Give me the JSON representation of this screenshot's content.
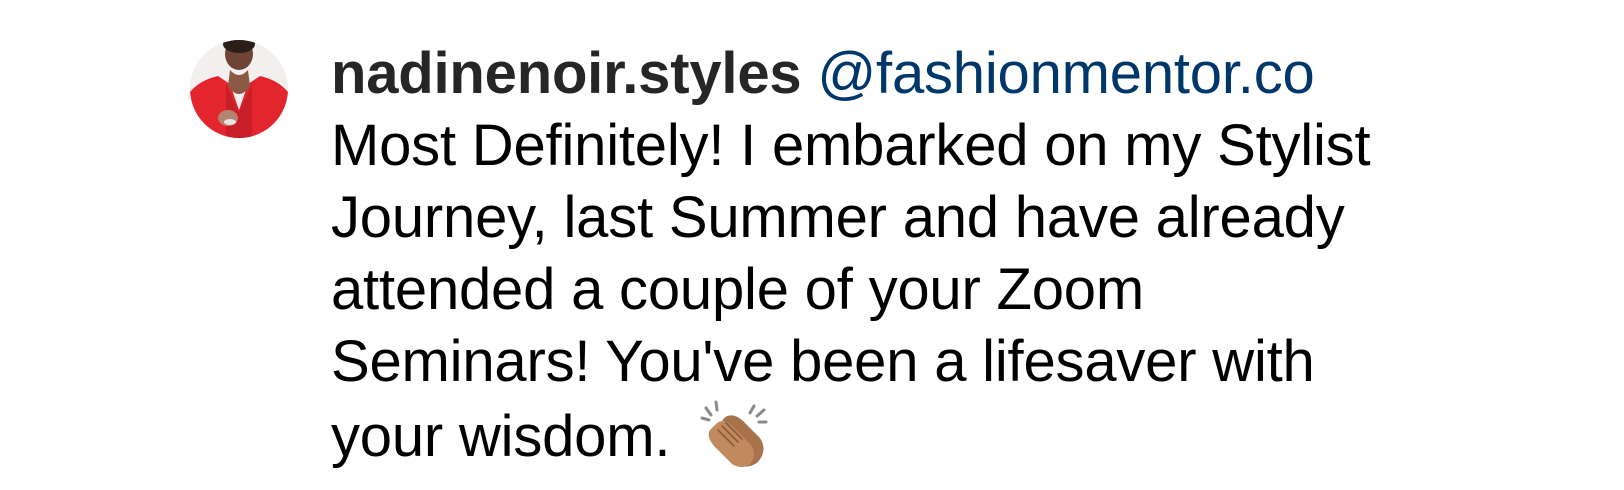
{
  "comment": {
    "username": "nadinenoir.styles",
    "mention": "@fashionmentor.co",
    "text_lines": [
      "Most Definitely! I embarked on my Stylist",
      "Journey, last Summer and have already",
      "attended a couple of your Zoom",
      "Seminars! You've been a lifesaver with",
      "your wisdom."
    ],
    "emoji": "clapping-hands-icon",
    "colors": {
      "username": "#262626",
      "mention": "#00376b",
      "avatar_accent": "#e3262d"
    }
  }
}
